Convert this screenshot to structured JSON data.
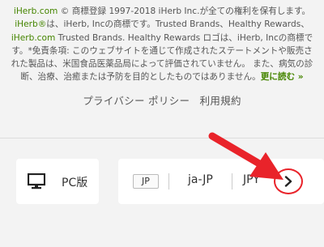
{
  "footer": {
    "legal": {
      "brand1": "iHerb.com",
      "part1": " © 商標登録 1997-2018 iHerb Inc.が全ての権利を保有します。",
      "brand2": "iHerb®",
      "part2": "は、iHerb, Incの商標です。Trusted Brands、Healthy Rewards、",
      "brand3": "iHerb.com",
      "part3": " Trusted Brands. Healthy Rewards ロゴは、iHerb, Incの商標です。*免責条項: このウェブサイトを通じて作成されたステートメントや販売された製品は、米国食品医薬品局によって評価されていません。 また、病気の診断、治療、治癒または予防を目的としたものではありません。",
      "read_more": "更に読む »"
    },
    "links": {
      "privacy": "プライバシー ポリシー",
      "terms": "利用規約"
    }
  },
  "settings": {
    "pc_label": "PC版",
    "country_code": "JP",
    "language": "ja-JP",
    "currency": "JPY",
    "next_icon": "chevron-right-icon"
  },
  "annotation": {
    "arrow_color": "#e9232a"
  }
}
